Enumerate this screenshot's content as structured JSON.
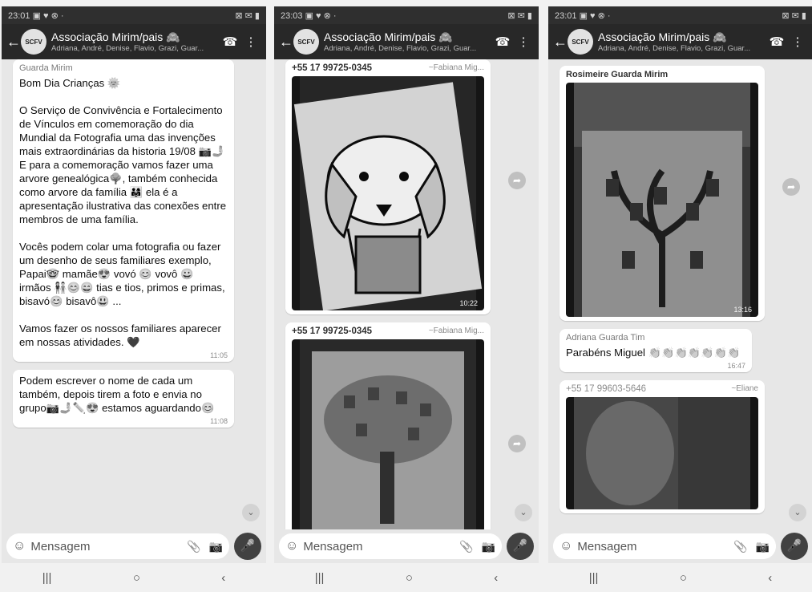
{
  "phones": [
    {
      "status_time": "23:01",
      "status_icons_left": "▣ ♥ ⊗ ·",
      "status_icons_right": "⊠ ✉ ▮",
      "title": "Associação Mirim/pais",
      "title_emoji": "🙈",
      "subtitle": "Adriana, André, Denise, Flavio, Grazi, Guar...",
      "input_placeholder": "Mensagem",
      "messages": [
        {
          "sender": "Guarda Mirim",
          "text": "Bom Dia Crianças 🌞\n\nO Serviço de Convivência e Fortalecimento de Vínculos em comemoração do dia Mundial da Fotografia uma das invenções mais extraordinárias da historia 19/08 📷🤳\nE para a comemoração vamos fazer uma arvore genealógica🌳, também conhecida como arvore da família 👨‍👩‍👧 ela é a apresentação ilustrativa das conexões entre membros de uma família.\n\nVocês podem colar uma fotografia ou fazer um desenho de seus familiares exemplo, Papai🤓 mamãe😍 vovó 😊 vovô 😀 irmãos 👫😊😄 tias e tios, primos e primas, bisavó😊 bisavô😃 ...\n\nVamos fazer os nossos familiares aparecer em nossas atividades. 🖤",
          "time": "11:05"
        },
        {
          "sender": "",
          "text": "Podem escrever o nome de cada um também, depois tirem a foto e envia no grupo📷🤳✏️😍 estamos aguardando😊",
          "time": "11:08"
        }
      ]
    },
    {
      "status_time": "23:03",
      "status_icons_left": "▣ ♥ ⊗ ·",
      "status_icons_right": "⊠ ✉ ▮",
      "title": "Associação Mirim/pais",
      "title_emoji": "🙈",
      "subtitle": "Adriana, André, Denise, Flavio, Grazi, Guar...",
      "input_placeholder": "Mensagem",
      "messages": [
        {
          "sender_number": "+55 17 99725-0345",
          "sender_alias": "~Fabiana Mig...",
          "time": "10:22"
        },
        {
          "sender_number": "+55 17 99725-0345",
          "sender_alias": "~Fabiana Mig...",
          "time": ""
        }
      ]
    },
    {
      "status_time": "23:01",
      "status_icons_left": "▣ ♥ ⊗ ·",
      "status_icons_right": "⊠ ✉ ▮",
      "title": "Associação Mirim/pais",
      "title_emoji": "🙈",
      "subtitle": "Adriana, André, Denise, Flavio, Grazi, Guar...",
      "input_placeholder": "Mensagem",
      "messages": [
        {
          "sender": "Rosimeire Guarda Mirim",
          "time": "13:16"
        },
        {
          "sender": "Adriana Guarda Tim",
          "text": "Parabéns Miguel 👏👏👏👏👏👏👏",
          "time": "16:47"
        },
        {
          "sender_number": "+55 17 99603-5646",
          "sender_alias": "~Eliane",
          "time": ""
        }
      ]
    }
  ],
  "avatar_text": "SCFV",
  "icons": {
    "back": "back-arrow-icon",
    "call": "call-add-icon",
    "menu": "overflow-menu-icon",
    "emoji": "emoji-icon",
    "attach": "attach-icon",
    "camera": "camera-icon",
    "mic": "mic-icon",
    "forward": "forward-icon",
    "scroll": "scroll-down-icon"
  },
  "nav": {
    "recent": "|||",
    "home": "○",
    "back": "‹"
  }
}
